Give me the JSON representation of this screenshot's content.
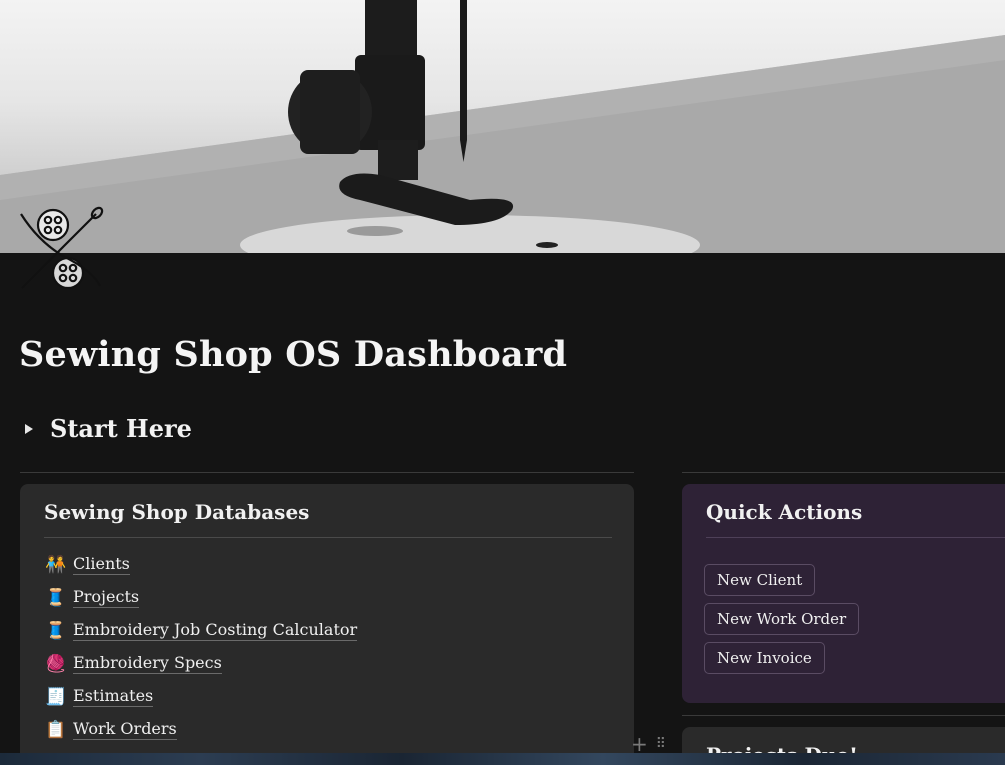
{
  "cover": {
    "image": "sewing-machine-needle-cover"
  },
  "page_icon": "needle-and-buttons-icon",
  "page_title": "Sewing Shop OS Dashboard",
  "toggle": {
    "label": "Start Here"
  },
  "databases": {
    "heading": "Sewing Shop Databases",
    "items": [
      {
        "icon": "people-holding-hands-icon",
        "emoji": "🧑‍🤝‍🧑",
        "label": "Clients"
      },
      {
        "icon": "thread-spool-icon",
        "emoji": "🧵",
        "label": "Projects"
      },
      {
        "icon": "thread-spool-icon",
        "emoji": "🧵",
        "label": "Embroidery Job Costing Calculator"
      },
      {
        "icon": "yarn-ball-icon",
        "emoji": "🧶",
        "label": "Embroidery Specs"
      },
      {
        "icon": "receipt-icon",
        "emoji": "🧾",
        "label": "Estimates"
      },
      {
        "icon": "clipboard-icon",
        "emoji": "📋",
        "label": "Work Orders"
      }
    ]
  },
  "quick_actions": {
    "heading": "Quick Actions",
    "buttons": [
      "New Client",
      "New Work Order",
      "New Invoice"
    ]
  },
  "projects_due": {
    "heading": "Projects Due!"
  },
  "colors": {
    "background": "#141414",
    "card": "#2a2a2a",
    "quick_actions_card": "#2e2236"
  }
}
